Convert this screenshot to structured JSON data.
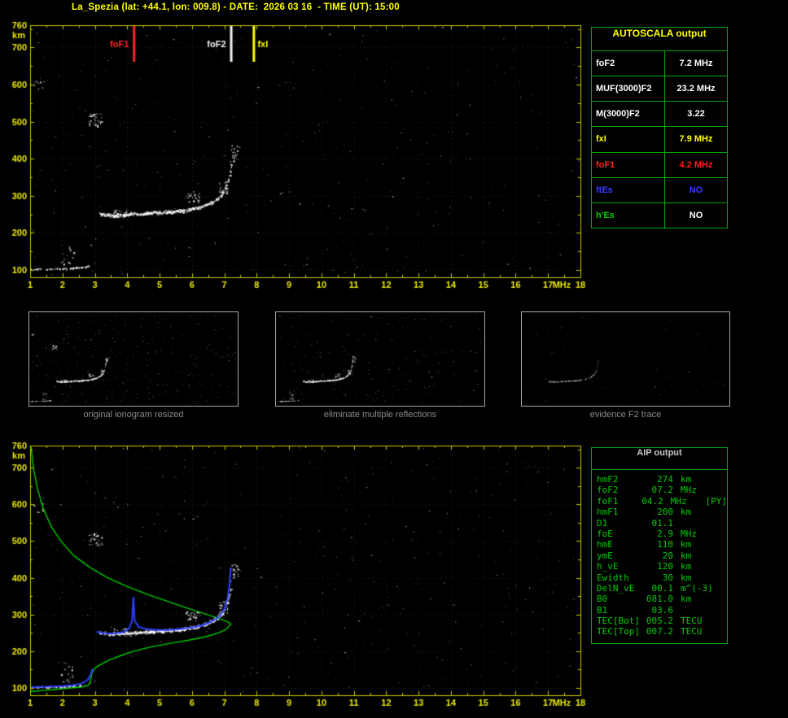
{
  "header": {
    "title": "La_Spezia (lat: +44.1, lon: 009.8) - DATE:  2026 03 16  - TIME (UT): 15:00"
  },
  "autoscala": {
    "title": "AUTOSCALA output",
    "rows": [
      {
        "label": "foF2",
        "value": "7.2 MHz",
        "label_color": "#ffffff",
        "value_color": "#ffffff"
      },
      {
        "label": "MUF(3000)F2",
        "value": "23.2 MHz",
        "label_color": "#ffffff",
        "value_color": "#ffffff"
      },
      {
        "label": "M(3000)F2",
        "value": "3.22",
        "label_color": "#ffffff",
        "value_color": "#ffffff"
      },
      {
        "label": "fxI",
        "value": "7.9 MHz",
        "label_color": "#ffff00",
        "value_color": "#ffff00"
      },
      {
        "label": "foF1",
        "value": "4.2 MHz",
        "label_color": "#ff2020",
        "value_color": "#ff2020"
      },
      {
        "label": "ftEs",
        "value": "NO",
        "label_color": "#3a3aff",
        "value_color": "#3a3aff"
      },
      {
        "label": "h'Es",
        "value": "NO",
        "label_color": "#00cc00",
        "value_color": "#ffffff"
      }
    ]
  },
  "aip": {
    "title": "AIP output",
    "rows": [
      {
        "name": "hmF2",
        "value": "274",
        "unit": "km",
        "extra": ""
      },
      {
        "name": "foF2",
        "value": "07.2",
        "unit": "MHz",
        "extra": ""
      },
      {
        "name": "foF1",
        "value": "04.2",
        "unit": "MHz",
        "extra": "[PY]"
      },
      {
        "name": "hmF1",
        "value": "200",
        "unit": "km",
        "extra": ""
      },
      {
        "name": "D1",
        "value": "01.1",
        "unit": "",
        "extra": ""
      },
      {
        "name": "foE",
        "value": "2.9",
        "unit": "MHz",
        "extra": ""
      },
      {
        "name": "hmE",
        "value": "110",
        "unit": "km",
        "extra": ""
      },
      {
        "name": "ymE",
        "value": "20",
        "unit": "km",
        "extra": ""
      },
      {
        "name": "h_vE",
        "value": "120",
        "unit": "km",
        "extra": ""
      },
      {
        "name": "Ewidth",
        "value": "30",
        "unit": "km",
        "extra": ""
      },
      {
        "name": "DelN_vE",
        "value": "00.1",
        "unit": "m^(-3)",
        "extra": ""
      },
      {
        "name": "B0",
        "value": "081.0",
        "unit": "km",
        "extra": ""
      },
      {
        "name": "B1",
        "value": "03.6",
        "unit": "",
        "extra": ""
      },
      {
        "name": "TEC[Bot]",
        "value": "005.2",
        "unit": "TECU",
        "extra": ""
      },
      {
        "name": "TEC[Top]",
        "value": "007.2",
        "unit": "TECU",
        "extra": ""
      }
    ]
  },
  "thumbnails": [
    {
      "caption": "original ionogram resized",
      "noise": 330,
      "trace_n": 260,
      "trace_alpha": 1,
      "blobs": "all",
      "seed": 21
    },
    {
      "caption": "eliminate multiple reflections",
      "noise": 250,
      "trace_n": 260,
      "trace_alpha": 1,
      "blobs": "no_multiples",
      "seed": 22
    },
    {
      "caption": "evidence F2 trace",
      "noise": 60,
      "trace_n": 150,
      "trace_alpha": 0.55,
      "blobs": "none",
      "seed": 23
    }
  ],
  "chart_data": {
    "type": "scatter",
    "xlabel": "MHz",
    "ylabel": "km",
    "x_range": [
      1,
      18
    ],
    "y_range": [
      80,
      760
    ],
    "x_ticks": [
      1,
      2,
      3,
      4,
      5,
      6,
      7,
      8,
      9,
      10,
      11,
      12,
      13,
      14,
      15,
      16,
      17,
      18
    ],
    "y_ticks": [
      760,
      700,
      600,
      500,
      400,
      300,
      200,
      100
    ],
    "x_unit": "MHz",
    "y_unit": "km",
    "axis_color": "#e8e800",
    "border_color": "#c8c800",
    "grid_color": "rgba(230,230,60,0.16)",
    "dot_color": "#ffffff",
    "noise": {
      "count": 420,
      "seed_top": 7,
      "seed_bottom": 8
    },
    "e_trace": [
      [
        1.0,
        103
      ],
      [
        1.6,
        103
      ],
      [
        2.2,
        105
      ],
      [
        2.6,
        107
      ],
      [
        2.85,
        113
      ]
    ],
    "f_trace": [
      [
        3.15,
        252
      ],
      [
        3.5,
        248
      ],
      [
        3.9,
        249
      ],
      [
        4.3,
        252
      ],
      [
        4.7,
        254
      ],
      [
        5.1,
        256
      ],
      [
        5.5,
        259
      ],
      [
        5.9,
        263
      ],
      [
        6.2,
        269
      ],
      [
        6.5,
        278
      ],
      [
        6.75,
        290
      ],
      [
        6.95,
        308
      ],
      [
        7.1,
        335
      ],
      [
        7.2,
        375
      ],
      [
        7.28,
        415
      ]
    ],
    "blobs": [
      {
        "f": [
          2.8,
          3.2
        ],
        "h": [
          488,
          522
        ],
        "n": 35
      },
      {
        "f": [
          5.8,
          6.25
        ],
        "h": [
          283,
          312
        ],
        "n": 30
      },
      {
        "f": [
          6.82,
          7.1
        ],
        "h": [
          300,
          338
        ],
        "n": 28
      },
      {
        "f": [
          1.95,
          2.35
        ],
        "h": [
          115,
          170
        ],
        "n": 18
      },
      {
        "f": [
          7.18,
          7.5
        ],
        "h": [
          392,
          440
        ],
        "n": 24
      },
      {
        "f": [
          3.55,
          4.1
        ],
        "h": [
          243,
          263
        ],
        "n": 26
      },
      {
        "f": [
          1.1,
          1.45
        ],
        "h": [
          575,
          625
        ],
        "n": 10
      }
    ],
    "top_markers": [
      {
        "label": "foF1",
        "mhz": 4.2,
        "color": "#ff2626"
      },
      {
        "label": "foF2",
        "mhz": 7.2,
        "color": "#f2f2f2"
      },
      {
        "label": "fxI",
        "mhz": 7.9,
        "color": "#ffff00"
      }
    ],
    "profile_green": {
      "color": "#00cc00",
      "points": [
        [
          1.03,
          757
        ],
        [
          1.1,
          700
        ],
        [
          1.22,
          645
        ],
        [
          1.4,
          590
        ],
        [
          1.65,
          540
        ],
        [
          1.95,
          500
        ],
        [
          2.35,
          460
        ],
        [
          2.85,
          428
        ],
        [
          3.4,
          400
        ],
        [
          4.0,
          376
        ],
        [
          4.7,
          352
        ],
        [
          5.4,
          331
        ],
        [
          6.0,
          313
        ],
        [
          6.5,
          299
        ],
        [
          6.9,
          287
        ],
        [
          7.1,
          280
        ],
        [
          7.2,
          274
        ],
        [
          7.05,
          259
        ],
        [
          6.8,
          249
        ],
        [
          6.4,
          239
        ],
        [
          5.9,
          230
        ],
        [
          5.3,
          221
        ],
        [
          4.7,
          211
        ],
        [
          4.2,
          200
        ],
        [
          3.8,
          188
        ],
        [
          3.45,
          176
        ],
        [
          3.2,
          165
        ],
        [
          3.0,
          154
        ],
        [
          2.92,
          143
        ],
        [
          2.88,
          128
        ],
        [
          2.85,
          112
        ],
        [
          2.78,
          106
        ],
        [
          2.55,
          102
        ],
        [
          2.2,
          99
        ],
        [
          1.8,
          96
        ],
        [
          1.4,
          93
        ],
        [
          1.0,
          90
        ]
      ]
    },
    "restored_blue": {
      "color": "#2b3fff",
      "e_points": [
        [
          1.0,
          102
        ],
        [
          1.5,
          103
        ],
        [
          2.0,
          105
        ],
        [
          2.4,
          108
        ],
        [
          2.62,
          113
        ],
        [
          2.78,
          122
        ],
        [
          2.88,
          138
        ],
        [
          2.93,
          152
        ]
      ],
      "f_points": [
        [
          3.05,
          253
        ],
        [
          3.3,
          249
        ],
        [
          3.6,
          248
        ],
        [
          3.9,
          252
        ],
        [
          4.05,
          261
        ],
        [
          4.15,
          283
        ],
        [
          4.19,
          348
        ],
        [
          4.23,
          284
        ],
        [
          4.35,
          266
        ],
        [
          4.6,
          260
        ],
        [
          4.9,
          258
        ],
        [
          5.3,
          258
        ],
        [
          5.7,
          261
        ],
        [
          6.05,
          265
        ],
        [
          6.35,
          271
        ],
        [
          6.6,
          280
        ],
        [
          6.85,
          294
        ],
        [
          7.0,
          314
        ],
        [
          7.1,
          344
        ],
        [
          7.16,
          382
        ],
        [
          7.2,
          428
        ]
      ]
    }
  }
}
